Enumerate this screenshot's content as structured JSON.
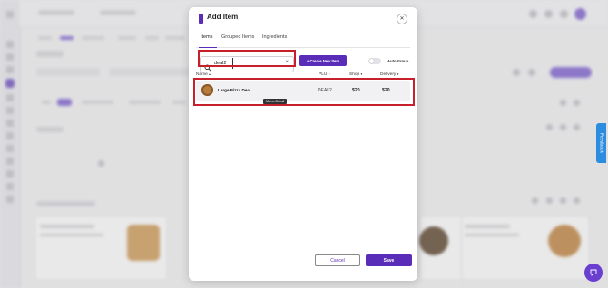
{
  "modal": {
    "title": "Add Item",
    "close_icon": "close-icon",
    "tabs": [
      {
        "label": "Items",
        "active": true
      },
      {
        "label": "Grouped Items",
        "active": false
      },
      {
        "label": "Ingredients",
        "active": false
      }
    ]
  },
  "search": {
    "value": "deal2",
    "clear_glyph": "×"
  },
  "create_button": {
    "label": "+ Create New Item"
  },
  "auto_group": {
    "label": "Auto Group",
    "on": false
  },
  "table": {
    "columns": [
      "Name",
      "PLU",
      "Shop",
      "Delivery"
    ],
    "rows": [
      {
        "name": "Large Pizza Deal",
        "plu": "DEAL2",
        "shop": "$20",
        "delivery": "$20"
      }
    ]
  },
  "tooltip": "Menu Detail",
  "footer": {
    "cancel_label": "Cancel",
    "save_label": "Save"
  },
  "feedback_tab": "Feedback",
  "colors": {
    "accent": "#5a2db8",
    "highlight": "#c8202a",
    "feedback": "#2c8de0"
  }
}
